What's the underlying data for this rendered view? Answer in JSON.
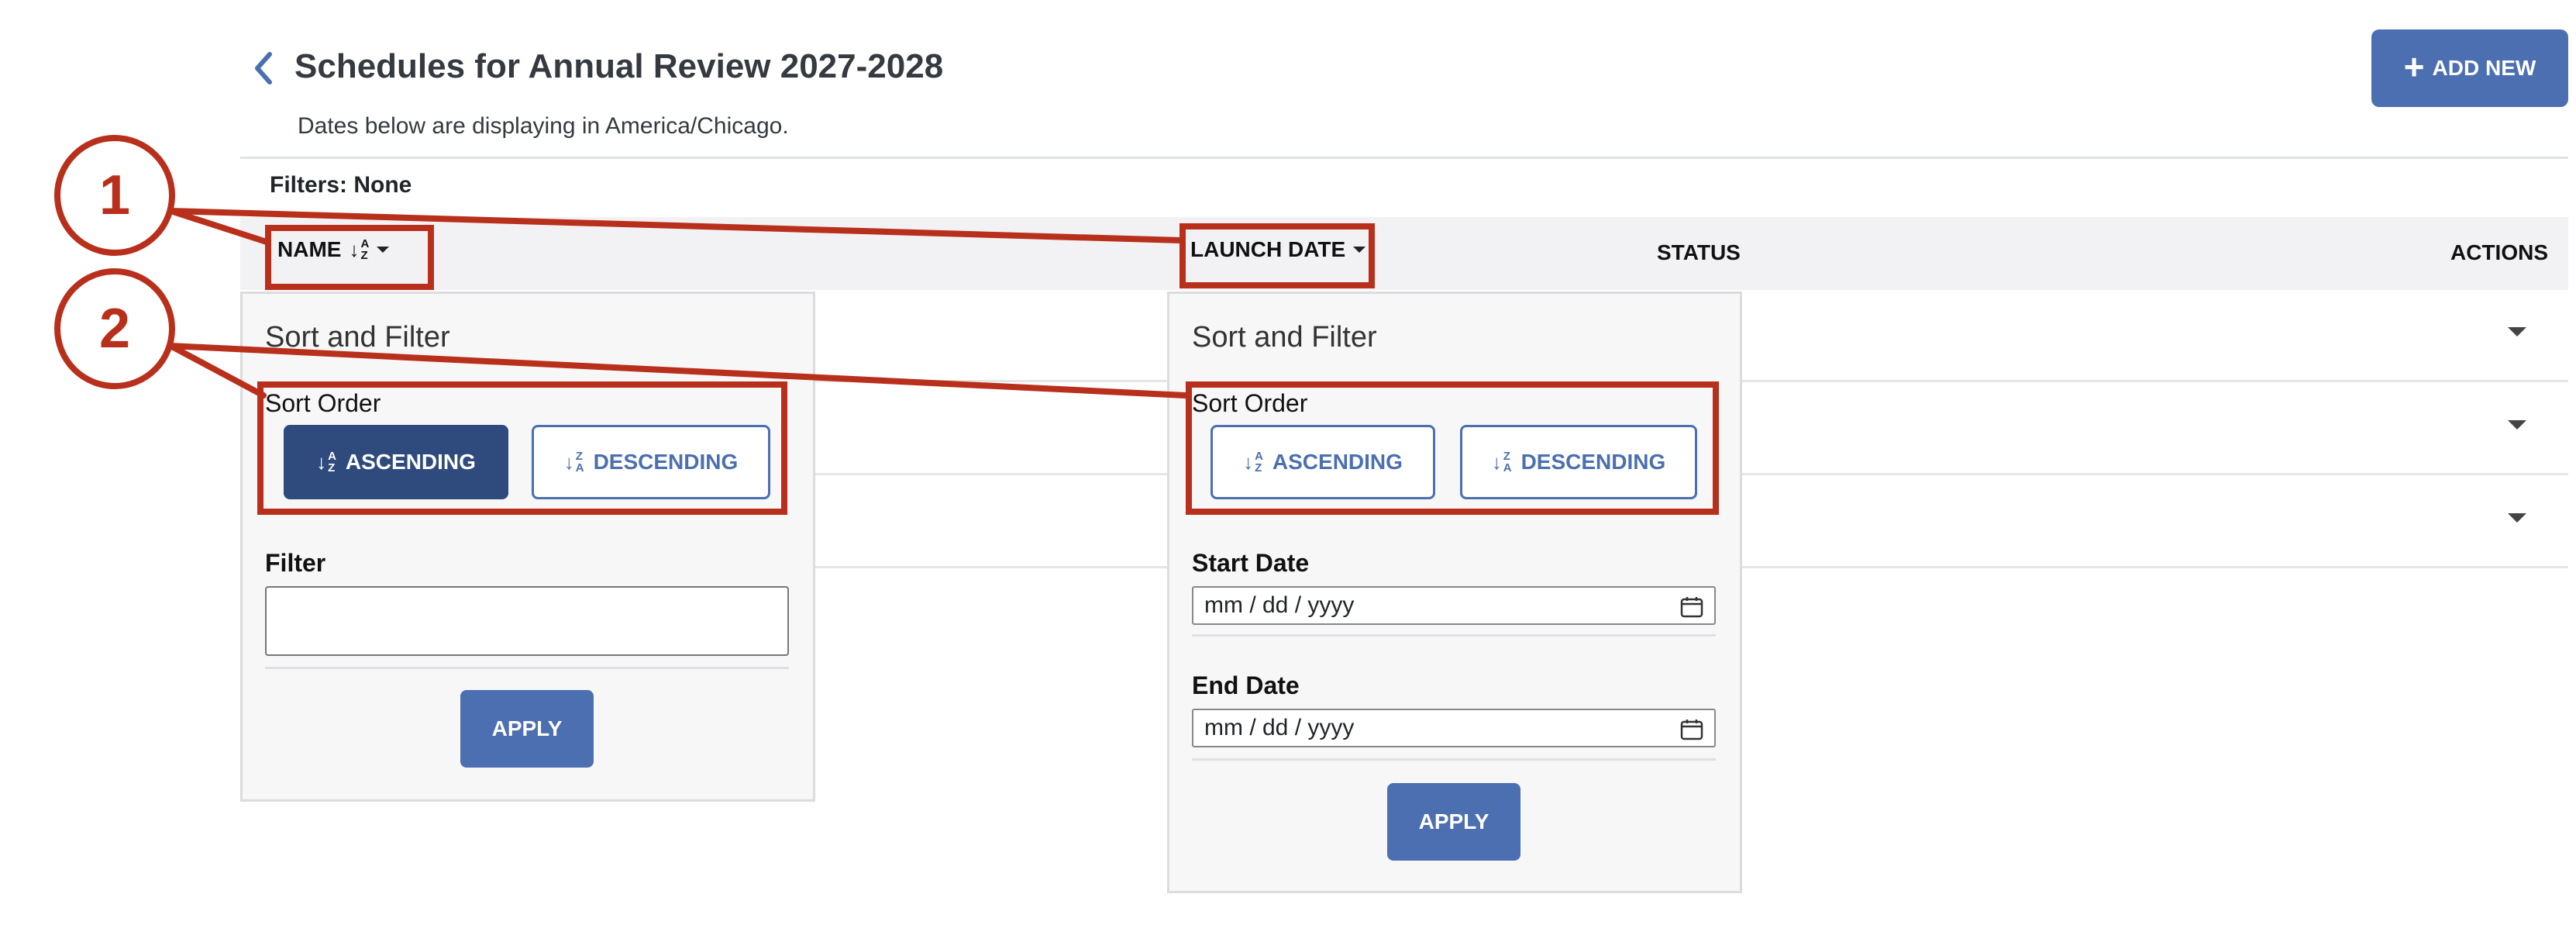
{
  "header": {
    "title": "Schedules for Annual Review 2027-2028",
    "subtitle": "Dates below are displaying in America/Chicago.",
    "add_new_label": "ADD NEW"
  },
  "filters_label": "Filters: None",
  "table": {
    "columns": {
      "name": "NAME",
      "launch_date": "LAUNCH DATE",
      "status": "STATUS",
      "actions": "ACTIONS"
    },
    "row_count": 3
  },
  "popover_name": {
    "title": "Sort and Filter",
    "sort_order_label": "Sort Order",
    "ascending_label": "ASCENDING",
    "descending_label": "DESCENDING",
    "filter_label": "Filter",
    "filter_value": "",
    "apply_label": "APPLY",
    "selected_sort": "ascending"
  },
  "popover_launch": {
    "title": "Sort and Filter",
    "sort_order_label": "Sort Order",
    "ascending_label": "ASCENDING",
    "descending_label": "DESCENDING",
    "start_date_label": "Start Date",
    "start_date_placeholder": "mm / dd / yyyy",
    "end_date_label": "End Date",
    "end_date_placeholder": "mm / dd / yyyy",
    "apply_label": "APPLY"
  },
  "annotations": [
    {
      "number": "1"
    },
    {
      "number": "2"
    }
  ],
  "colors": {
    "accent": "#4b6fb0",
    "accent_dark": "#2f4a7d",
    "annotation": "#b8301b"
  }
}
